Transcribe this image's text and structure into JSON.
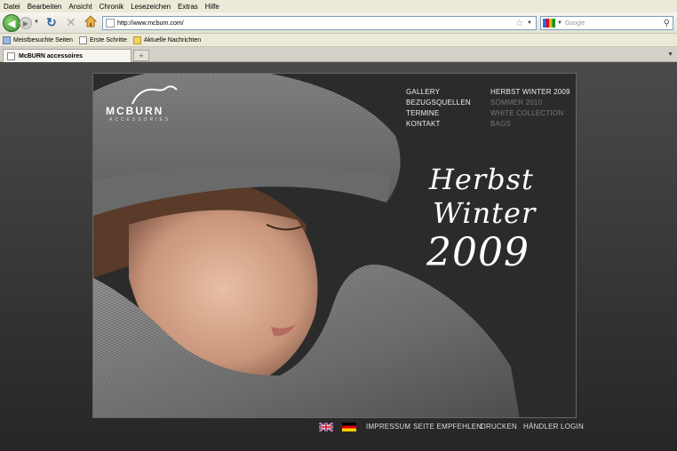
{
  "browser": {
    "menu": [
      "Datei",
      "Bearbeiten",
      "Ansicht",
      "Chronik",
      "Lesezeichen",
      "Extras",
      "Hilfe"
    ],
    "url": "http://www.mcburn.com/",
    "search_placeholder": "Google",
    "bookmarks": [
      "Meistbesuchte Seiten",
      "Erste Schritte",
      "Aktuelle Nachrichten"
    ],
    "tab_title": "McBURN accessoires"
  },
  "site": {
    "logo": "MCBURN",
    "logo_sub": "ACCESSORIES",
    "nav_left": [
      "GALLERY",
      "BEZUGSQUELLEN",
      "TERMINE",
      "KONTAKT"
    ],
    "nav_right": [
      "HERBST WINTER 2009",
      "SOMMER 2010",
      "WHITE COLLECTION",
      "BAGS"
    ],
    "headline": [
      "Herbst",
      "Winter",
      "2009"
    ],
    "footer": [
      "IMPRESSUM",
      "SEITE EMPFEHLEN",
      "DRUCKEN",
      "HÄNDLER LOGIN"
    ]
  },
  "colors": {
    "background": "#3a3a3a",
    "stage": "#2b2b2b",
    "nav_active": "#eeeeee",
    "nav_dim": "#777777"
  }
}
